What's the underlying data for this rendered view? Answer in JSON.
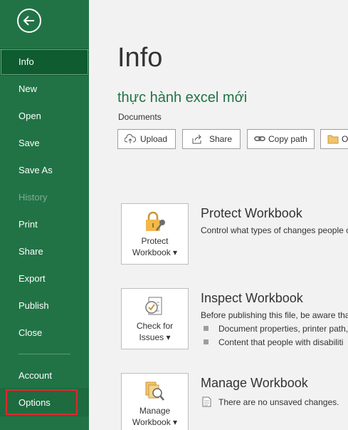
{
  "sidebar": {
    "items": [
      {
        "label": "Info"
      },
      {
        "label": "New"
      },
      {
        "label": "Open"
      },
      {
        "label": "Save"
      },
      {
        "label": "Save As"
      },
      {
        "label": "History"
      },
      {
        "label": "Print"
      },
      {
        "label": "Share"
      },
      {
        "label": "Export"
      },
      {
        "label": "Publish"
      },
      {
        "label": "Close"
      },
      {
        "label": "Account"
      },
      {
        "label": "Options"
      }
    ]
  },
  "main": {
    "title": "Info",
    "file_name": "thực hành excel mới",
    "location": "Documents",
    "buttons": {
      "upload": "Upload",
      "share": "Share",
      "copy_path": "Copy path",
      "open_location": "O"
    },
    "protect": {
      "button": "Protect\nWorkbook",
      "btn_line1": "Protect",
      "btn_line2": "Workbook ▾",
      "title": "Protect Workbook",
      "desc": "Control what types of changes people c"
    },
    "inspect": {
      "btn_line1": "Check for",
      "btn_line2": "Issues ▾",
      "title": "Inspect Workbook",
      "desc": "Before publishing this file, be aware tha",
      "bullets": [
        "Document properties, printer path,",
        "Content that people with disabiliti"
      ]
    },
    "manage": {
      "btn_line1": "Manage",
      "btn_line2": "Workbook ▾",
      "title": "Manage Workbook",
      "desc": "There are no unsaved changes."
    }
  },
  "colors": {
    "accent": "#217346",
    "selected": "#0e5c2f",
    "highlight": "#e0282c"
  }
}
